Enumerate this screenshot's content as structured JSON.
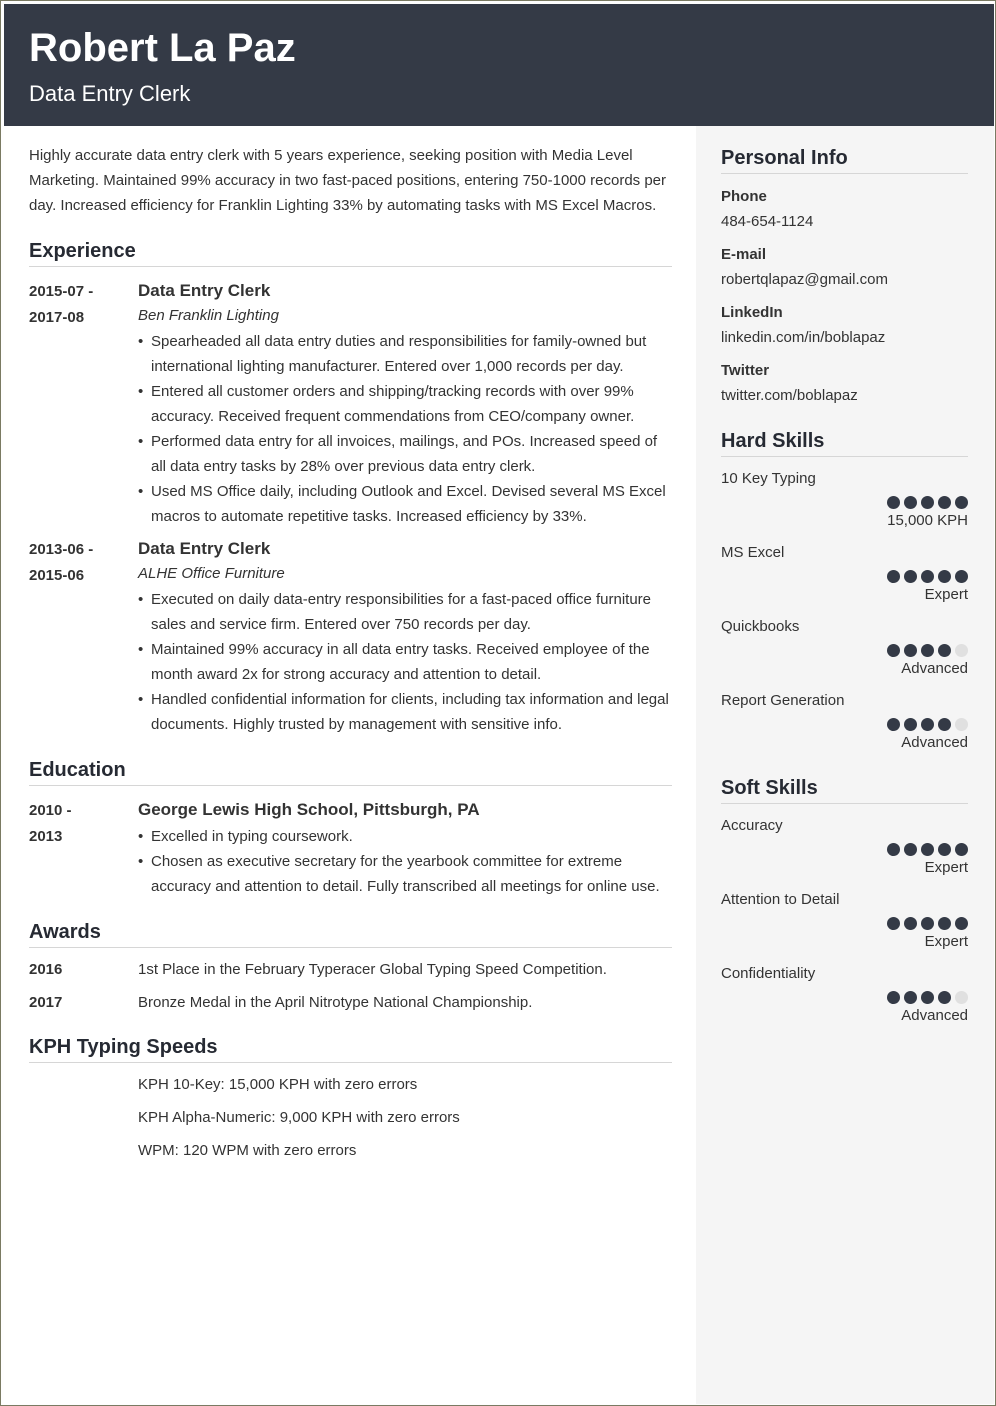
{
  "header": {
    "name": "Robert La Paz",
    "title": "Data Entry Clerk"
  },
  "summary": "Highly accurate data entry clerk with 5 years experience, seeking position with Media Level Marketing. Maintained 99% accuracy in two fast-paced positions, entering 750-1000 records per day. Increased efficiency for Franklin Lighting 33% by automating tasks with MS Excel Macros.",
  "experience": {
    "title": "Experience",
    "entries": [
      {
        "date_start": "2015-07 -",
        "date_end": "2017-08",
        "role": "Data Entry Clerk",
        "company": "Ben Franklin Lighting",
        "bullets": [
          "Spearheaded all data entry duties and responsibilities for family-owned but international lighting manufacturer. Entered over 1,000 records per day.",
          "Entered all customer orders and shipping/tracking records with over 99% accuracy. Received frequent commendations from CEO/company owner.",
          "Performed data entry for all invoices, mailings, and POs. Increased speed of all data entry tasks by 28% over previous data entry clerk.",
          "Used MS Office daily, including Outlook and Excel. Devised several MS Excel macros to automate repetitive tasks. Increased efficiency by 33%."
        ]
      },
      {
        "date_start": "2013-06 -",
        "date_end": "2015-06",
        "role": "Data Entry Clerk",
        "company": "ALHE Office Furniture",
        "bullets": [
          "Executed on daily data-entry responsibilities for a fast-paced office furniture sales and service firm. Entered over 750 records per day.",
          "Maintained 99% accuracy in all data entry tasks. Received employee of the month award 2x for strong accuracy and attention to detail.",
          "Handled confidential information for clients, including tax information and legal documents. Highly trusted by management with sensitive info."
        ]
      }
    ]
  },
  "education": {
    "title": "Education",
    "entries": [
      {
        "date_start": "2010 -",
        "date_end": "2013",
        "school": "George Lewis High School, Pittsburgh, PA",
        "bullets": [
          "Excelled in typing coursework.",
          "Chosen as executive secretary for the yearbook committee for extreme accuracy and attention to detail. Fully transcribed all meetings for online use."
        ]
      }
    ]
  },
  "awards": {
    "title": "Awards",
    "items": [
      {
        "year": "2016",
        "text": "1st Place in the February Typeracer Global Typing Speed Competition."
      },
      {
        "year": "2017",
        "text": "Bronze Medal in the April Nitrotype National Championship."
      }
    ]
  },
  "typing": {
    "title": "KPH Typing Speeds",
    "items": [
      "KPH 10-Key: 15,000 KPH with zero errors",
      "KPH Alpha-Numeric: 9,000 KPH with zero errors",
      "WPM: 120 WPM with zero errors"
    ]
  },
  "personal": {
    "title": "Personal Info",
    "items": [
      {
        "label": "Phone",
        "value": "484-654-1124"
      },
      {
        "label": "E-mail",
        "value": "robertqlapaz@gmail.com"
      },
      {
        "label": "LinkedIn",
        "value": "linkedin.com/in/boblapaz"
      },
      {
        "label": "Twitter",
        "value": "twitter.com/boblapaz"
      }
    ]
  },
  "hard_skills": {
    "title": "Hard Skills",
    "items": [
      {
        "name": "10 Key Typing",
        "rating": 5,
        "max": 5,
        "level": "15,000 KPH"
      },
      {
        "name": "MS Excel",
        "rating": 5,
        "max": 5,
        "level": "Expert"
      },
      {
        "name": "Quickbooks",
        "rating": 4,
        "max": 5,
        "level": "Advanced"
      },
      {
        "name": "Report Generation",
        "rating": 4,
        "max": 5,
        "level": "Advanced"
      }
    ]
  },
  "soft_skills": {
    "title": "Soft Skills",
    "items": [
      {
        "name": "Accuracy",
        "rating": 5,
        "max": 5,
        "level": "Expert"
      },
      {
        "name": "Attention to Detail",
        "rating": 5,
        "max": 5,
        "level": "Expert"
      },
      {
        "name": "Confidentiality",
        "rating": 4,
        "max": 5,
        "level": "Advanced"
      }
    ]
  },
  "colors": {
    "header_bg": "#343a46",
    "dot_filled": "#343a46",
    "dot_empty": "#e0e0e0",
    "sidebar_bg": "#f5f5f5"
  }
}
